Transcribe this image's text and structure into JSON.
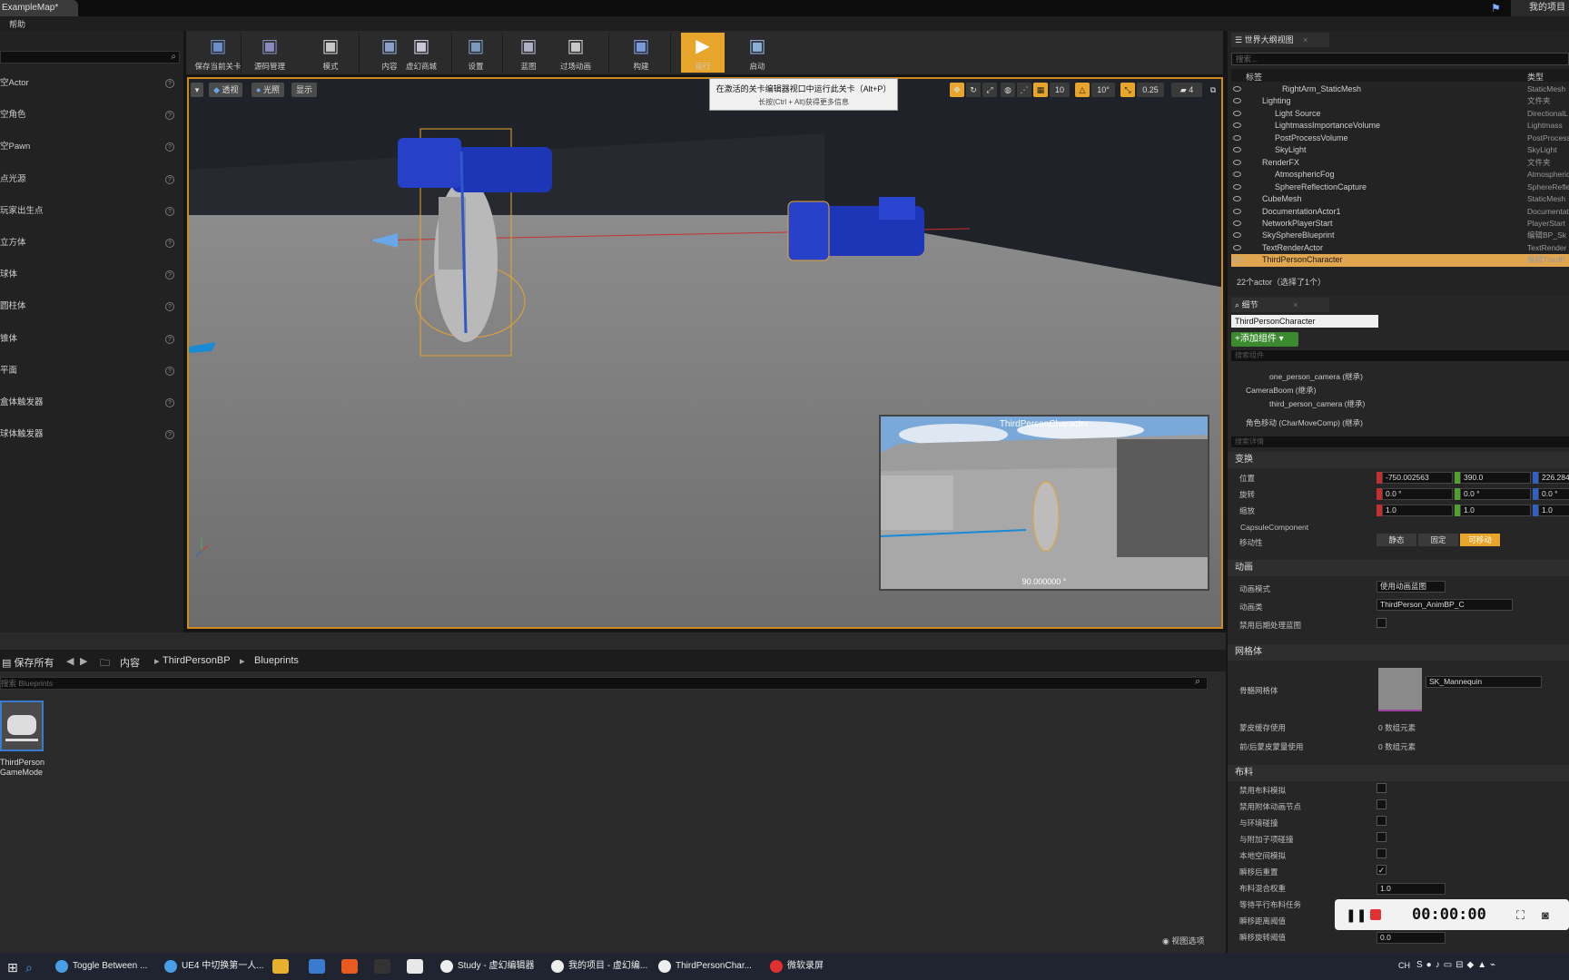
{
  "window": {
    "tab_title": "ExampleMap*",
    "project_label": "我的项目"
  },
  "menu": {
    "help": "帮助"
  },
  "place_panel": {
    "items": [
      "空Actor",
      "空角色",
      "空Pawn",
      "点光源",
      "玩家出生点",
      "立方体",
      "球体",
      "圆柱体",
      "锥体",
      "平面",
      "盒体触发器",
      "球体触发器"
    ]
  },
  "toolbar": {
    "buttons": [
      "保存当前关卡",
      "源码管理",
      "模式",
      "内容",
      "虚幻商城",
      "设置",
      "蓝图",
      "过场动画",
      "构建",
      "运行",
      "启动"
    ]
  },
  "viewport": {
    "perspective": "透视",
    "lit": "光照",
    "show": "显示",
    "grid_snap": "10",
    "rot_snap": "10°",
    "scale_snap": "0.25",
    "cam_speed": "4",
    "pip_title": "ThirdPersonCharacter",
    "pip_angle": "90.000000 °"
  },
  "tooltip": {
    "title": "在激活的关卡编辑器视口中运行此关卡（Alt+P）",
    "sub": "长按(Ctrl + Alt)获得更多信息"
  },
  "content_browser": {
    "save_all": "保存所有",
    "path": [
      "内容",
      "ThirdPersonBP",
      "Blueprints"
    ],
    "search_placeholder": "搜索 Blueprints",
    "asset_label": "ThirdPerson GameMode",
    "view_options": "视图选项"
  },
  "outliner": {
    "tab": "世界大纲视图",
    "search_placeholder": "搜索...",
    "col_label": "标签",
    "col_type": "类型",
    "rows": [
      {
        "name": "RightArm_StaticMesh",
        "type": "StaticMesh"
      },
      {
        "name": "Lighting",
        "type": "文件夹"
      },
      {
        "name": "Light Source",
        "type": "DirectionalL"
      },
      {
        "name": "LightmassImportanceVolume",
        "type": "Lightmass"
      },
      {
        "name": "PostProcessVolume",
        "type": "PostProcess"
      },
      {
        "name": "SkyLight",
        "type": "SkyLight"
      },
      {
        "name": "RenderFX",
        "type": "文件夹"
      },
      {
        "name": "AtmosphericFog",
        "type": "Atmospheric"
      },
      {
        "name": "SphereReflectionCapture",
        "type": "SphereRefle"
      },
      {
        "name": "CubeMesh",
        "type": "StaticMesh"
      },
      {
        "name": "DocumentationActor1",
        "type": "Documentatio"
      },
      {
        "name": "NetworkPlayerStart",
        "type": "PlayerStart"
      },
      {
        "name": "SkySphereBlueprint",
        "type": "编辑BP_Sk"
      },
      {
        "name": "TextRenderActor",
        "type": "TextRender"
      },
      {
        "name": "ThirdPersonCharacter",
        "type": "编辑ThirdP"
      }
    ],
    "count": "22个actor（选择了1个）"
  },
  "details": {
    "tab": "细节",
    "name_value": "ThirdPersonCharacter",
    "add_component": "+添加组件 ▾",
    "search_components": "搜索组件",
    "components": [
      "one_person_camera (继承)",
      "CameraBoom (继承)",
      "third_person_camera (继承)",
      "角色移动 (CharMoveComp) (继承)"
    ],
    "search_details": "搜索详情",
    "transform": {
      "section": "变换",
      "location_label": "位置",
      "rotation_label": "旋转",
      "scale_label": "缩放",
      "location": [
        "-750.002563",
        "390.0",
        "226.284"
      ],
      "rotation": [
        "0.0 °",
        "0.0 °",
        "0.0 °"
      ],
      "scale": [
        "1.0",
        "1.0",
        "1.0"
      ]
    },
    "capsule": "CapsuleComponent",
    "mobility_label": "移动性",
    "mobility": [
      "静态",
      "固定",
      "可移动"
    ],
    "animation": {
      "section": "动画",
      "mode_label": "动画模式",
      "mode_value": "使用动画蓝图",
      "class_label": "动画类",
      "class_value": "ThirdPerson_AnimBP_C",
      "disable_post": "禁用后期处理蓝图"
    },
    "mesh": {
      "section": "网格体",
      "skeletal_label": "骨骼网格体",
      "skeletal_value": "SK_Mannequin",
      "skin_cache": "蒙皮缓存使用",
      "skin_cache_val": "0 数组元素",
      "morph": "前/后蒙皮蒙量使用",
      "morph_val": "0 数组元素"
    },
    "cloth": {
      "section": "布料",
      "rows": [
        "禁用布料模拟",
        "禁用附体动画节点",
        "与环境碰撞",
        "与附加子项碰撞",
        "本地空间模拟",
        "瞬移后重置",
        "布料混合权重",
        "等待平行布料任务",
        "瞬移距离阈值",
        "瞬移旋转阈值"
      ],
      "blend_val": "1.0",
      "rot_thresh_val": "0.0"
    }
  },
  "recorder": {
    "time": "00:00:00"
  },
  "taskbar": {
    "tasks": [
      "Toggle Between ...",
      "UE4 中切换第一人...",
      "Study - 虚幻编辑器",
      "我的项目 - 虚幻编...",
      "ThirdPersonChar...",
      "微软录屏"
    ],
    "lang": "CH"
  }
}
